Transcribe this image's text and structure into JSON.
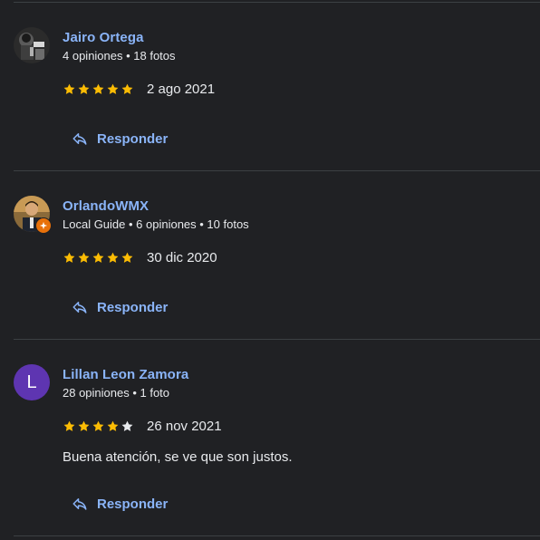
{
  "colors": {
    "background": "#202124",
    "link": "#8ab4f8",
    "text": "#e8eaed",
    "star_filled": "#fbbc04",
    "star_empty": "#e8eaed",
    "divider": "#3c4043",
    "local_guide_badge": "#e8710a"
  },
  "reviews": [
    {
      "author": "Jairo Ortega",
      "meta": "4 opiniones • 18 fotos",
      "avatar": "photo",
      "rating": 5,
      "date": "2 ago 2021",
      "text": "",
      "reply_label": "Responder"
    },
    {
      "author": "OrlandoWMX",
      "meta": "Local Guide • 6 opiniones • 10 fotos",
      "avatar": "photo",
      "local_guide_badge_icon": "star-badge-icon",
      "rating": 5,
      "date": "30 dic 2020",
      "text": "",
      "reply_label": "Responder"
    },
    {
      "author": "Lillan Leon Zamora",
      "meta": "28 opiniones • 1 foto",
      "avatar": "letter",
      "avatar_letter": "L",
      "avatar_color": "#5e35b1",
      "rating": 4,
      "date": "26 nov 2021",
      "text": "Buena atención, se ve que son justos.",
      "reply_label": "Responder"
    }
  ],
  "icons": {
    "reply": "reply-arrow-icon",
    "star": "star-icon"
  }
}
